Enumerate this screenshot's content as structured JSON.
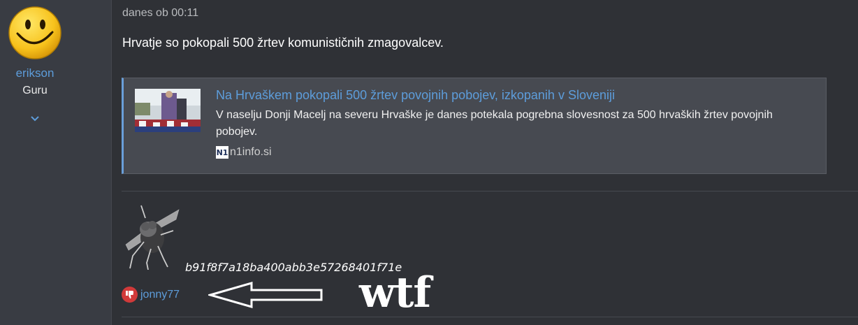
{
  "user": {
    "name": "erikson",
    "role": "Guru",
    "avatar_icon": "smiley-face-icon",
    "expand_icon": "chevron-down-icon"
  },
  "post": {
    "timestamp": "danes ob 00:11",
    "text": "Hrvatje so pokopali 500 žrtev komunističnih zmagovalcev."
  },
  "embed": {
    "title": "Na Hrvaškem pokopali 500 žrtev povojnih pobojev, izkopanih v Sloveniji",
    "description": "V naselju Donji Macelj na severu Hrvaške je danes potekala pogrebna slovesnost za 500 hrvaških žrtev povojnih pobojev.",
    "source_icon_text": "N1",
    "source": "n1info.si",
    "accent_color": "#6a9fd9"
  },
  "signature": {
    "image_icon": "fly-image",
    "hash": "b91f8f7a18ba400abb3e57268401f71e"
  },
  "reactions": [
    {
      "icon": "thumbs-down-icon",
      "user": "jonny77",
      "color": "#d13a3a"
    }
  ],
  "annotation": {
    "arrow_icon": "left-arrow-icon",
    "text": "wtf"
  }
}
